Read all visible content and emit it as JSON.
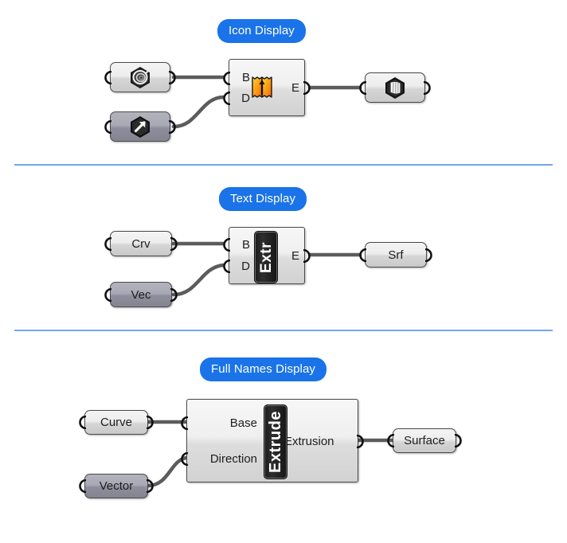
{
  "page": {
    "background": "#ffffff",
    "accent_blue": "#1a73e8",
    "divider_color": "#70a8e8"
  },
  "sections": [
    {
      "id": "icon-display",
      "label": "Icon Display",
      "inputs": [
        {
          "name": "curve-param",
          "display": "icon",
          "icon": "curve-icon",
          "style": "default"
        },
        {
          "name": "vector-param",
          "display": "icon",
          "icon": "vector-icon",
          "style": "vector"
        }
      ],
      "component": {
        "name": "extrude-component",
        "display": "icon",
        "icon": "extrude-icon",
        "input_ports": [
          "B",
          "D"
        ],
        "output_ports": [
          "E"
        ]
      },
      "outputs": [
        {
          "name": "surface-param",
          "display": "icon",
          "icon": "surface-icon",
          "style": "default"
        }
      ]
    },
    {
      "id": "text-display",
      "label": "Text Display",
      "inputs": [
        {
          "name": "curve-param",
          "display": "text",
          "text": "Crv",
          "style": "default"
        },
        {
          "name": "vector-param",
          "display": "text",
          "text": "Vec",
          "style": "vector"
        }
      ],
      "component": {
        "name": "extrude-component",
        "display": "text",
        "nameplate": "Extr",
        "input_ports": [
          "B",
          "D"
        ],
        "output_ports": [
          "E"
        ]
      },
      "outputs": [
        {
          "name": "surface-param",
          "display": "text",
          "text": "Srf",
          "style": "default"
        }
      ]
    },
    {
      "id": "full-names-display",
      "label": "Full Names Display",
      "inputs": [
        {
          "name": "curve-param",
          "display": "text",
          "text": "Curve",
          "style": "default"
        },
        {
          "name": "vector-param",
          "display": "text",
          "text": "Vector",
          "style": "vector"
        }
      ],
      "component": {
        "name": "extrude-component",
        "display": "text",
        "nameplate": "Extrude",
        "input_ports": [
          "Base",
          "Direction"
        ],
        "output_ports": [
          "Extrusion"
        ]
      },
      "outputs": [
        {
          "name": "surface-param",
          "display": "text",
          "text": "Surface",
          "style": "default"
        }
      ]
    }
  ]
}
